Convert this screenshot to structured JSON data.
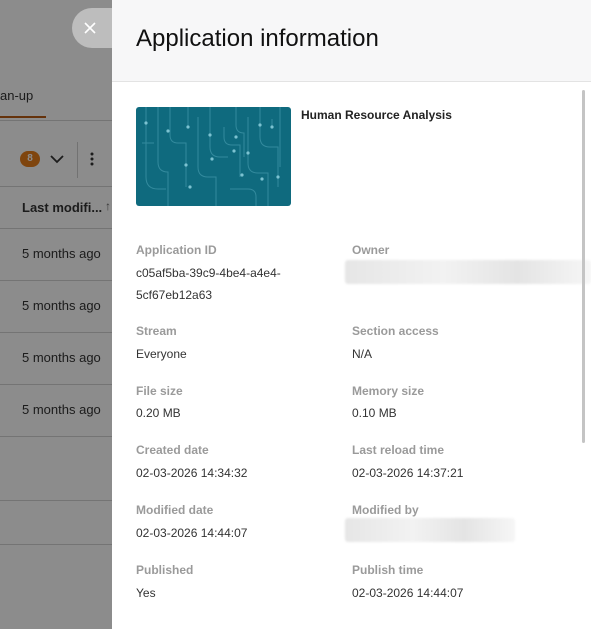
{
  "background": {
    "tab_label": "an-up",
    "filter_count": "8",
    "column_header": "Last modifi...",
    "sort_icon": "↑",
    "rows": [
      "5 months ago",
      "5 months ago",
      "5 months ago",
      "5 months ago"
    ]
  },
  "dialog": {
    "title": "Application information",
    "app_name": "Human Resource Analysis",
    "fields": {
      "application_id": {
        "label": "Application ID",
        "value_line1": "c05af5ba-39c9-4be4-a4e4-",
        "value_line2": "5cf67eb12a63"
      },
      "owner": {
        "label": "Owner"
      },
      "stream": {
        "label": "Stream",
        "value": "Everyone"
      },
      "section_access": {
        "label": "Section access",
        "value": "N/A"
      },
      "file_size": {
        "label": "File size",
        "value": "0.20 MB"
      },
      "memory_size": {
        "label": "Memory size",
        "value": "0.10 MB"
      },
      "created_date": {
        "label": "Created date",
        "value": "02-03-2026 14:34:32"
      },
      "last_reload_time": {
        "label": "Last reload time",
        "value": "02-03-2026 14:37:21"
      },
      "modified_date": {
        "label": "Modified date",
        "value": "02-03-2026 14:44:07"
      },
      "modified_by": {
        "label": "Modified by"
      },
      "published": {
        "label": "Published",
        "value": "Yes"
      },
      "publish_time": {
        "label": "Publish time",
        "value": "02-03-2026 14:44:07"
      }
    }
  },
  "colors": {
    "accent_orange": "#e87e1b",
    "thumbnail_teal": "#0f6a7e"
  }
}
